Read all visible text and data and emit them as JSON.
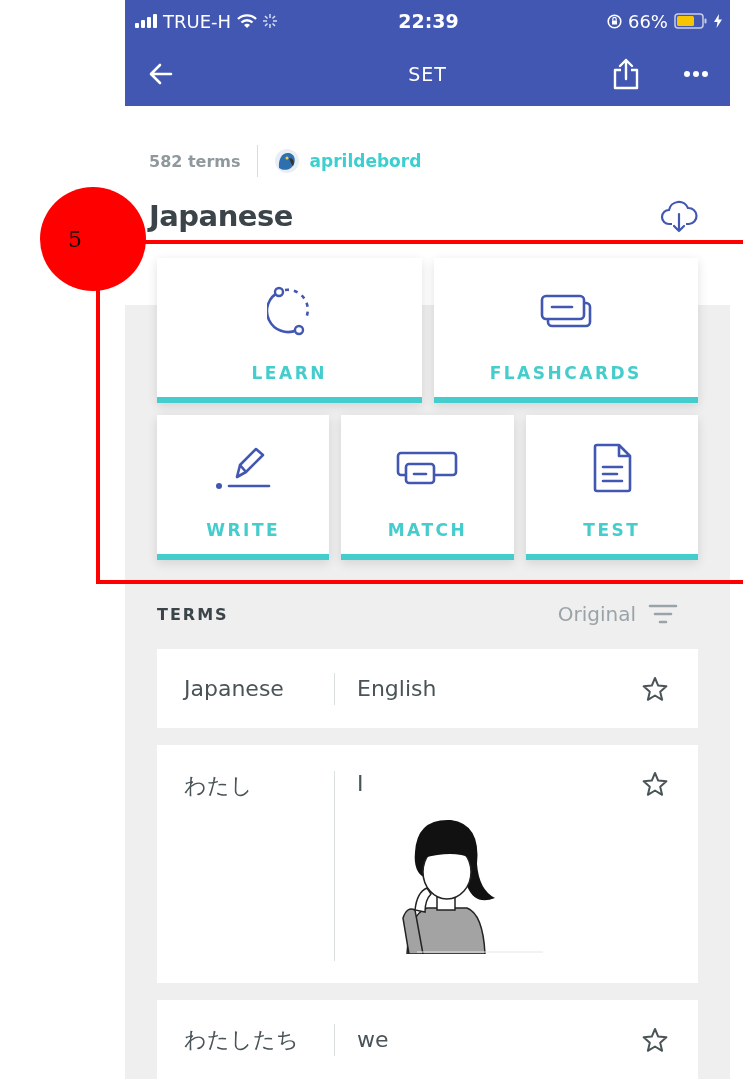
{
  "status_bar": {
    "carrier": "TRUE-H",
    "time": "22:39",
    "battery": "66%"
  },
  "nav_bar": {
    "title": "SET"
  },
  "set": {
    "term_count": "582 terms",
    "author": "aprildebord",
    "title": "Japanese"
  },
  "study_modes": [
    {
      "label": "LEARN",
      "kind": "learn"
    },
    {
      "label": "FLASHCARDS",
      "kind": "flashcards"
    },
    {
      "label": "WRITE",
      "kind": "write"
    },
    {
      "label": "MATCH",
      "kind": "match"
    },
    {
      "label": "TEST",
      "kind": "test"
    }
  ],
  "terms_header": {
    "title": "TERMS",
    "sort": "Original"
  },
  "language_row": {
    "term": "Japanese",
    "definition": "English",
    "starred": false
  },
  "terms": [
    {
      "term": "わたし",
      "definition": "I",
      "starred": false
    },
    {
      "term": "わたしたち",
      "definition": "we",
      "starred": false
    }
  ],
  "annotation": {
    "label": "5"
  }
}
